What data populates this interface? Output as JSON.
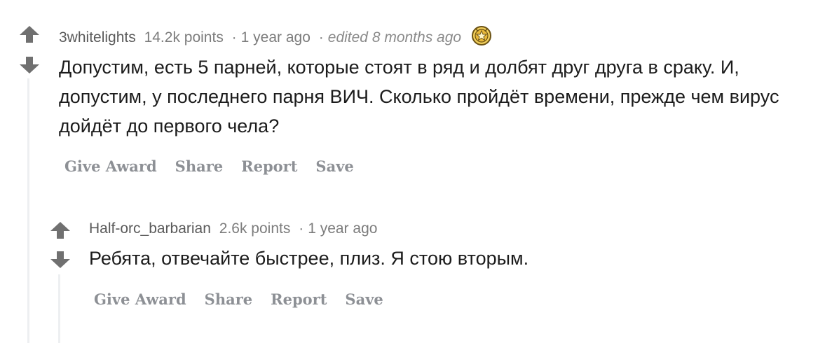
{
  "comments": [
    {
      "author": "3whitelights",
      "points": "14.2k points",
      "time": "1 year ago",
      "edited": "edited 8 months ago",
      "award_icon": "gold-star-award-icon",
      "text": "Допустим, есть 5 парней, которые стоят в ряд и долбят друг друга в сраку. И, допустим, у последнего парня ВИЧ. Сколько пройдёт времени, прежде чем вирус дойдёт до первого чела?",
      "actions": {
        "give_award": "Give Award",
        "share": "Share",
        "report": "Report",
        "save": "Save"
      }
    },
    {
      "author": "Half-orc_barbarian",
      "points": "2.6k points",
      "time": "1 year ago",
      "text": "Ребята, отвечайте быстрее, плиз. Я стою вторым.",
      "actions": {
        "give_award": "Give Award",
        "share": "Share",
        "report": "Report",
        "save": "Save"
      }
    }
  ],
  "separator": "·",
  "colors": {
    "vote_arrow": "#707070",
    "meta_text": "#7c7c7c",
    "action_text": "#8d9095",
    "thread_line": "#edeff1",
    "award_gold": "#e8b93b"
  }
}
